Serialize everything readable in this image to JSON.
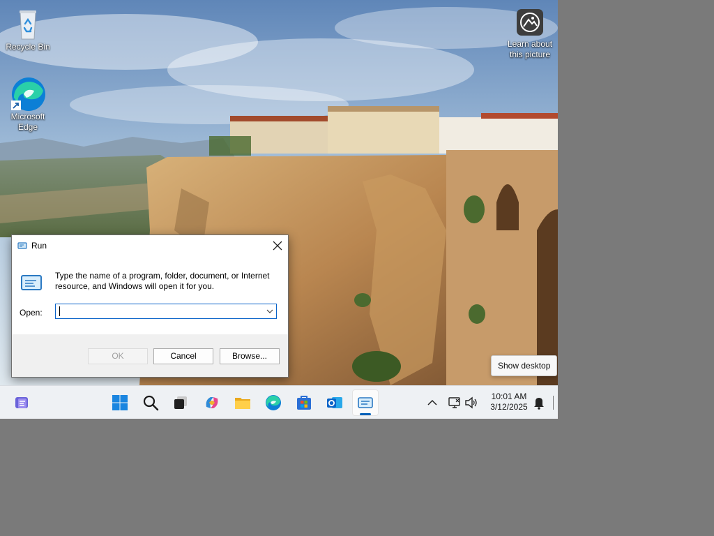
{
  "desktop": {
    "icons": [
      {
        "label": "Recycle Bin",
        "icon": "recycle-bin-icon"
      },
      {
        "label": "Microsoft Edge",
        "label_line1": "Microsoft",
        "label_line2": "Edge",
        "icon": "edge-icon"
      },
      {
        "label_line1": "Learn about",
        "label_line2": "this picture",
        "icon": "camera-info-icon"
      }
    ]
  },
  "run_dialog": {
    "title": "Run",
    "message": "Type the name of a program, folder, document, or Internet resource, and Windows will open it for you.",
    "open_label": "Open:",
    "open_value": "",
    "buttons": {
      "ok": "OK",
      "cancel": "Cancel",
      "browse": "Browse..."
    },
    "ok_enabled": false
  },
  "tooltip": {
    "text": "Show desktop"
  },
  "taskbar": {
    "apps": [
      {
        "name": "Widgets",
        "icon": "widgets-icon"
      },
      {
        "name": "Start",
        "icon": "windows-start-icon"
      },
      {
        "name": "Search",
        "icon": "search-icon"
      },
      {
        "name": "Task View",
        "icon": "task-view-icon"
      },
      {
        "name": "Copilot",
        "icon": "copilot-icon"
      },
      {
        "name": "File Explorer",
        "icon": "folder-icon"
      },
      {
        "name": "Microsoft Edge",
        "icon": "edge-icon"
      },
      {
        "name": "Microsoft Store",
        "icon": "store-icon"
      },
      {
        "name": "Outlook",
        "icon": "outlook-icon"
      },
      {
        "name": "Run",
        "icon": "run-icon",
        "active": true
      }
    ],
    "tray": {
      "time": "10:01 AM",
      "date": "3/12/2025"
    }
  },
  "colors": {
    "accent": "#005fb8",
    "taskbar_bg": "#eef1f4",
    "dialog_bg": "#f0f0f0",
    "outside_screen": "#7a7a7a"
  }
}
